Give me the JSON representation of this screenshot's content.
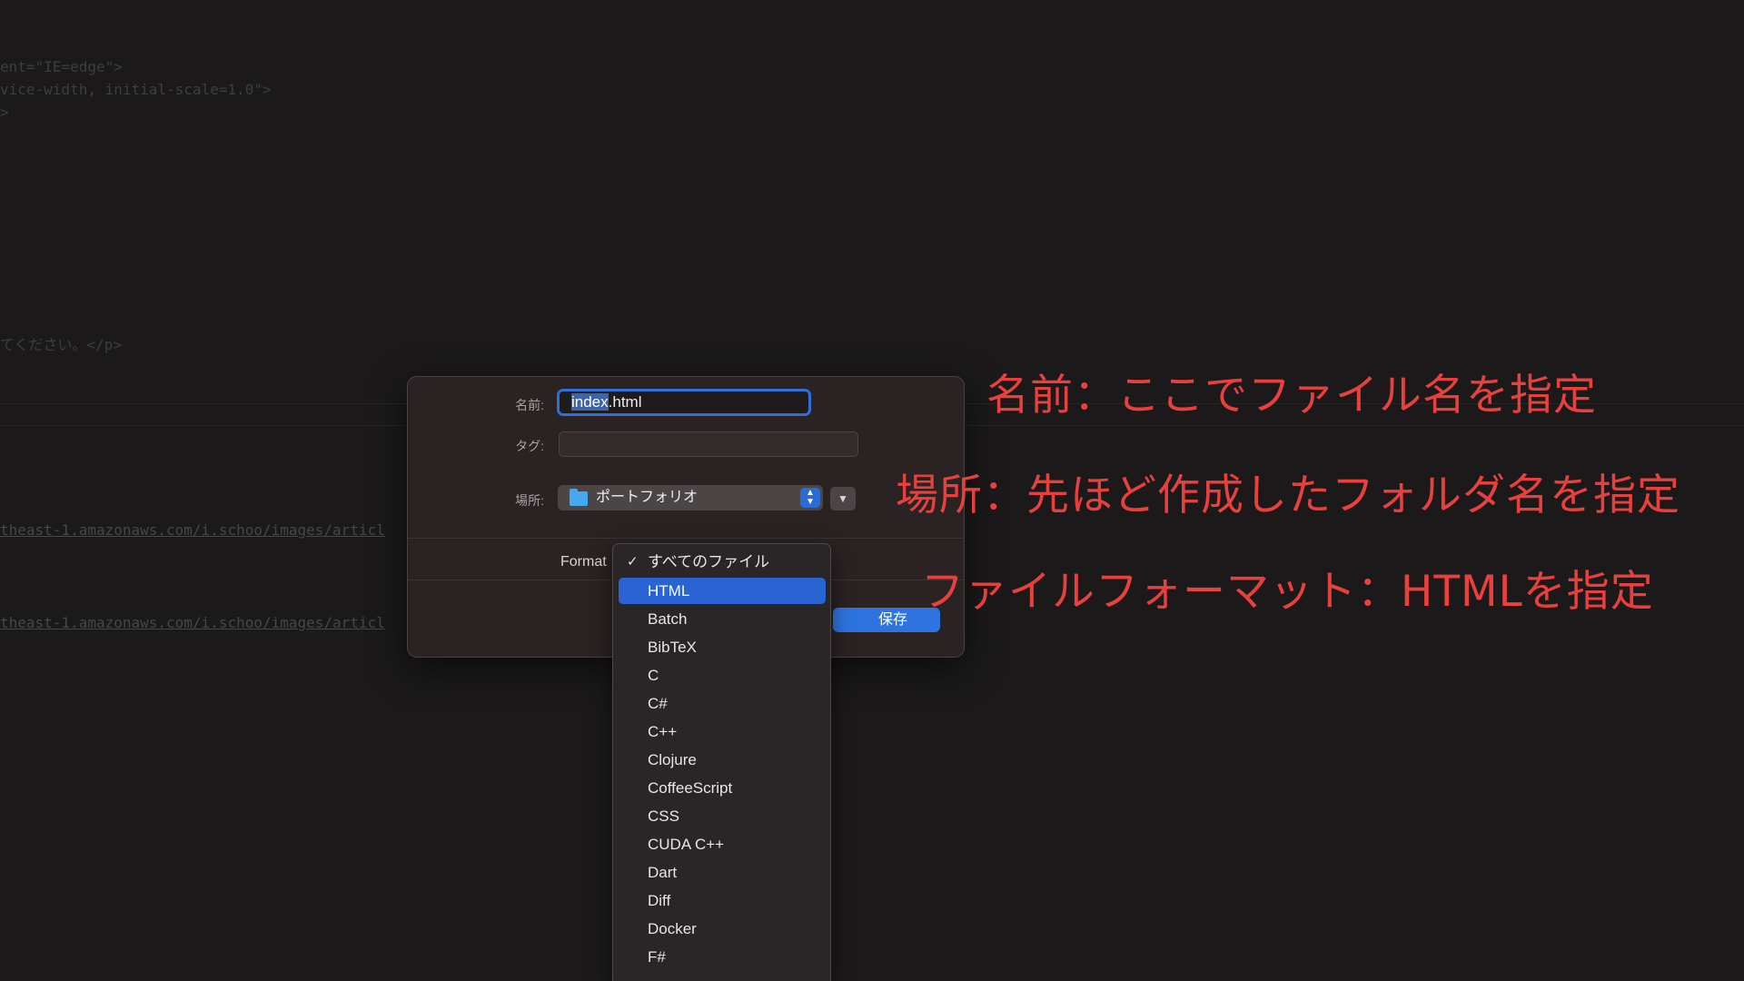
{
  "editor": {
    "lines": [
      {
        "text": "ent=\"IE=edge\">"
      },
      {
        "text": "vice-width, initial-scale=1.0\">"
      },
      {
        "text": ">"
      },
      {
        "text": "てください。</p>"
      },
      {
        "text": "theast-1.amazonaws.com/i.schoo/images/articl"
      },
      {
        "text": "theast-1.amazonaws.com/i.schoo/images/articl"
      }
    ]
  },
  "dialog": {
    "name_label": "名前:",
    "name_selected": "index",
    "name_rest": ".html",
    "tags_label": "タグ:",
    "location_label": "場所:",
    "location_value": "ポートフォリオ",
    "format_label": "Format",
    "save_label": "保存"
  },
  "format_menu": {
    "checkmark": "✓",
    "items": [
      {
        "label": "すべてのファイル"
      },
      {
        "label": "HTML"
      },
      {
        "label": "Batch"
      },
      {
        "label": "BibTeX"
      },
      {
        "label": "C"
      },
      {
        "label": "C#"
      },
      {
        "label": "C++"
      },
      {
        "label": "Clojure"
      },
      {
        "label": "CoffeeScript"
      },
      {
        "label": "CSS"
      },
      {
        "label": "CUDA C++"
      },
      {
        "label": "Dart"
      },
      {
        "label": "Diff"
      },
      {
        "label": "Docker"
      },
      {
        "label": "F#"
      }
    ]
  },
  "annotations": {
    "name": "名前：ここでファイル名を指定",
    "location": "場所：先ほど作成したフォルダ名を指定",
    "format": "ファイルフォーマット：HTMLを指定"
  },
  "colors": {
    "background": "#1b191a",
    "annotation": "#e8403d",
    "accent": "#2a64d3"
  },
  "icons": {
    "folder": "folder-icon",
    "updown": "chevron-updown-icon",
    "expand": "chevron-down-icon",
    "check": "checkmark-icon"
  }
}
